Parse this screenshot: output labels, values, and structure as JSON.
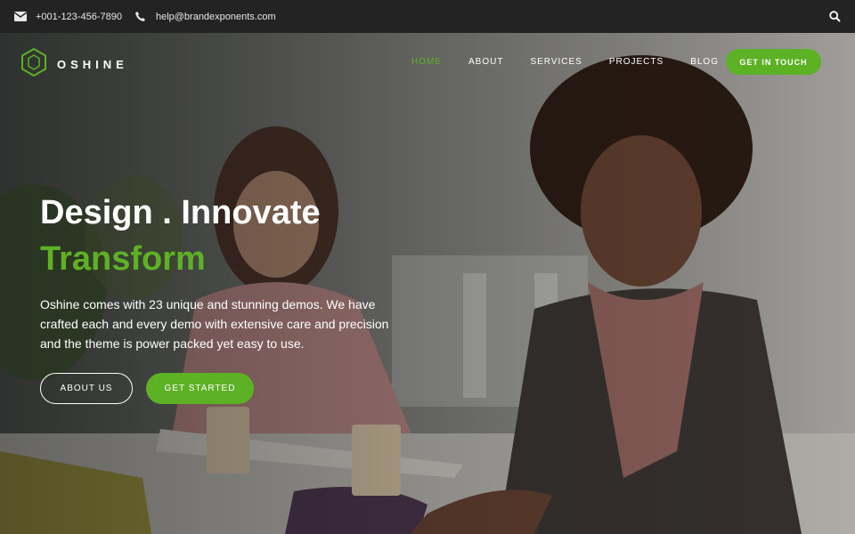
{
  "topbar": {
    "phone": "+001-123-456-7890",
    "email": "help@brandexponents.com"
  },
  "brand": {
    "name": "OSHINE",
    "accent_color": "#5db124"
  },
  "nav": {
    "items": [
      {
        "label": "HOME",
        "active": true
      },
      {
        "label": "ABOUT",
        "active": false
      },
      {
        "label": "SERVICES",
        "active": false
      },
      {
        "label": "PROJECTS",
        "active": false
      },
      {
        "label": "BLOG",
        "active": false
      }
    ],
    "cta_label": "GET IN TOUCH"
  },
  "hero": {
    "headline_line1": "Design . Innovate",
    "headline_line2": "Transform",
    "description": "Oshine comes with 23 unique and stunning demos. We have crafted each and every demo with extensive care and precision and the theme is power packed yet easy to use.",
    "buttons": {
      "secondary": "ABOUT US",
      "primary": "GET STARTED"
    }
  },
  "icons": [
    "envelope-icon",
    "phone-icon",
    "search-icon",
    "hexagon-logo-icon"
  ]
}
